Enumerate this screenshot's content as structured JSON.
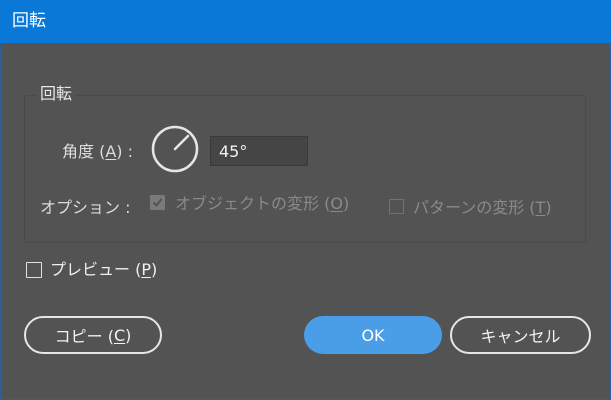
{
  "window": {
    "title": "回転"
  },
  "group": {
    "legend": "回転"
  },
  "angle": {
    "label_prefix": "角度 (",
    "label_accel": "A",
    "label_suffix": ") :",
    "value": "45°"
  },
  "options": {
    "label": "オプション :",
    "transform_objects": {
      "prefix": "オブジェクトの変形 (",
      "accel": "O",
      "suffix": ")",
      "checked": true,
      "enabled": false
    },
    "transform_patterns": {
      "prefix": "パターンの変形 (",
      "accel": "T",
      "suffix": ")",
      "checked": false,
      "enabled": false
    }
  },
  "preview": {
    "prefix": "プレビュー (",
    "accel": "P",
    "suffix": ")",
    "checked": false
  },
  "buttons": {
    "copy": {
      "prefix": "コピー (",
      "accel": "C",
      "suffix": ")"
    },
    "ok": "OK",
    "cancel": "キャンセル"
  },
  "colors": {
    "titlebar": "#0a78d7",
    "background": "#535353",
    "primary_button": "#4a9ee8"
  },
  "icons": {
    "dial": "angle-dial-icon",
    "check": "checkmark-icon"
  }
}
